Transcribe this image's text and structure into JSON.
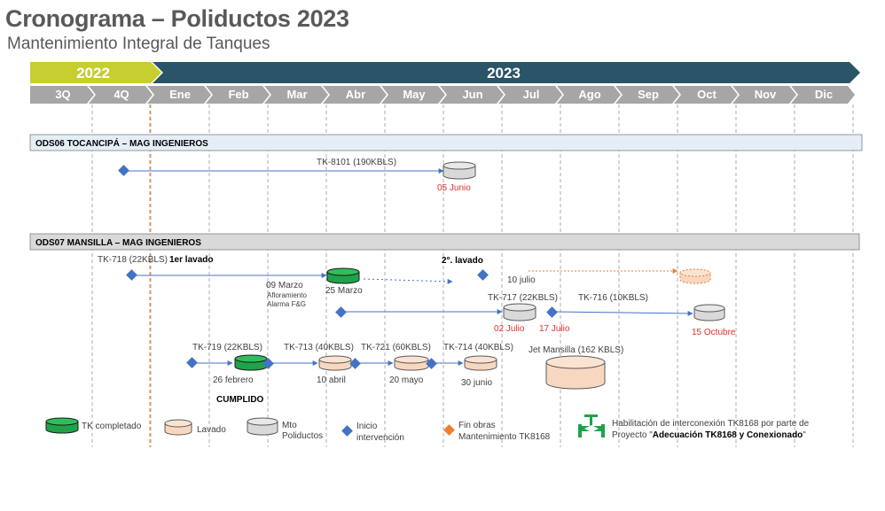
{
  "title": "Cronograma – Poliductos 2023",
  "subtitle": "Mantenimiento Integral de Tanques",
  "years": [
    "2022",
    "2023"
  ],
  "months": [
    "3Q",
    "4Q",
    "Ene",
    "Feb",
    "Mar",
    "Abr",
    "May",
    "Jun",
    "Jul",
    "Ago",
    "Sep",
    "Oct",
    "Nov",
    "Dic"
  ],
  "sections": {
    "ods06": "ODS06 TOCANCIPÁ – MAG INGENIEROS",
    "ods07": "ODS07 MANSILLA – MAG INGENIEROS"
  },
  "tasks": {
    "tk8101": {
      "label": "TK-8101 (190KBLS)",
      "date": "05 Junio"
    },
    "tk718": {
      "label": "TK-718 (22KBLS)",
      "phase1": "1er lavado",
      "phase2": "2°. lavado",
      "note1": "09 Marzo",
      "note2": "Afloramiento",
      "note3": "Alarma F&G",
      "date1": "25 Marzo",
      "date2": "10 julio"
    },
    "tk717": {
      "label": "TK-717 (22KBLS)",
      "date": "02 Julio"
    },
    "tk716": {
      "label": "TK-716 (10KBLS)",
      "start": "17 Julio",
      "date": "15 Octubre"
    },
    "tk719": {
      "label": "TK-719 (22KBLS)",
      "date": "26 febrero",
      "status": "CUMPLIDO"
    },
    "tk713": {
      "label": "TK-713 (40KBLS)",
      "date": "10 abril"
    },
    "tk721": {
      "label": "TK-721 (60KBLS)",
      "date": "20 mayo"
    },
    "tk714": {
      "label": "TK-714 (40KBLS)",
      "date": "30 junio"
    },
    "jet": {
      "label": "Jet Mansilla (162 KBLS)"
    }
  },
  "legend": {
    "completed": "TK completado",
    "lavado": "Lavado",
    "mto1": "Mto",
    "mto2": "Poliductos",
    "inicio1": "Inicio",
    "inicio2": "intervención",
    "fin1": "Fin obras",
    "fin2": "Mantenimiento TK8168",
    "hab1": "Habilitación de interconexión TK8168 por parte de",
    "hab2a": "Proyecto \"",
    "hab2b": "Adecuación TK8168 y Conexionado",
    "hab2c": "\""
  },
  "colors": {
    "year2022": "#c6cf2f",
    "year2023": "#2a5468",
    "months": "#a6a6a6",
    "completed": "#1ea34a",
    "lavado": "#f8d7c0",
    "mto": "#d9d9d9",
    "diamond": "#4472c4",
    "fin": "#ed7d31",
    "red": "#e03030"
  }
}
